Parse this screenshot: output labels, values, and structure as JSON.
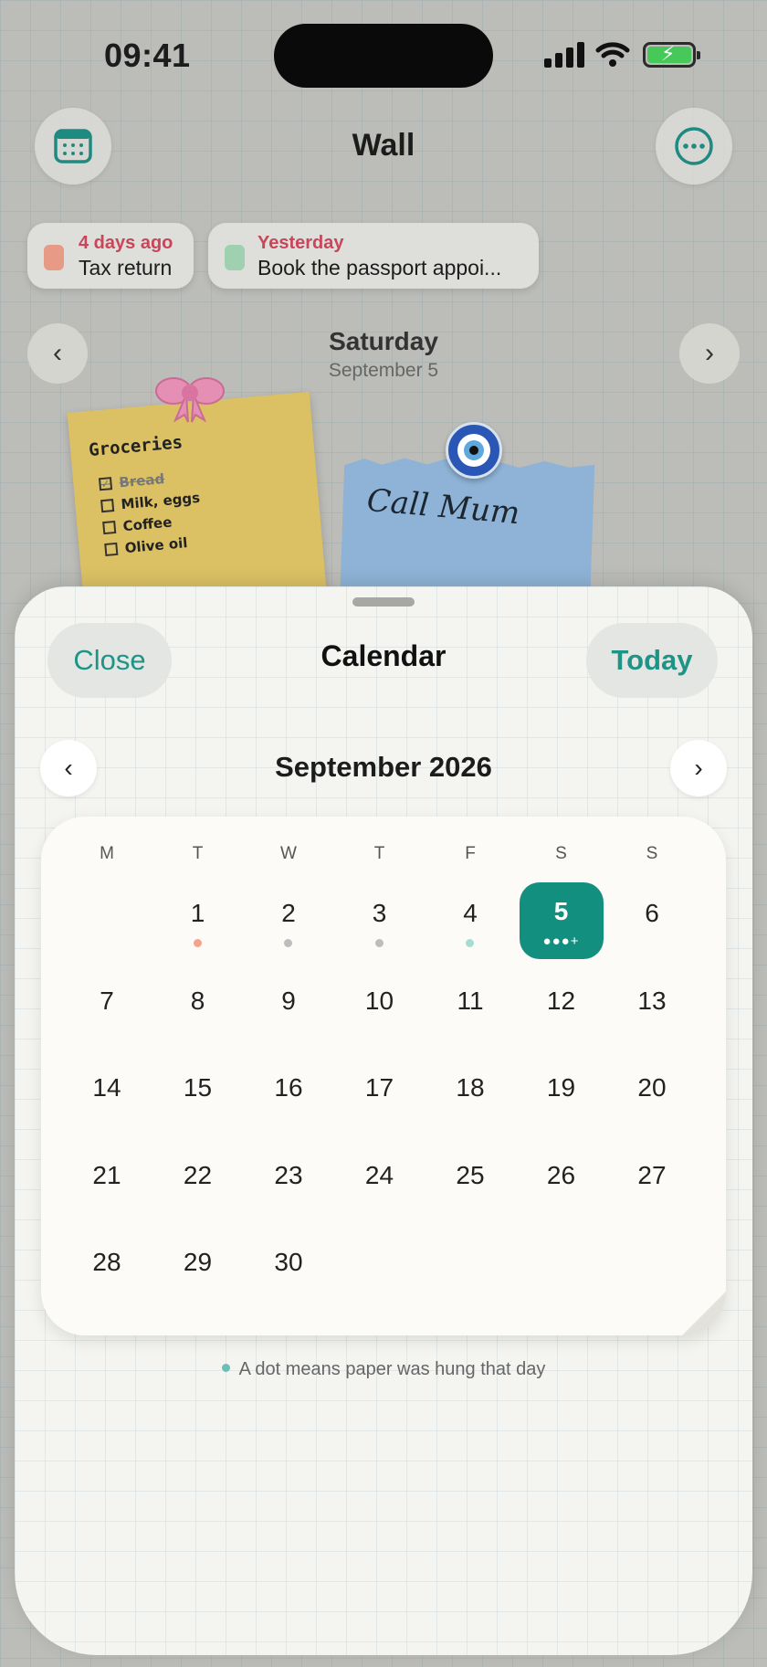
{
  "status": {
    "time": "09:41"
  },
  "header": {
    "title": "Wall"
  },
  "reminders": [
    {
      "when": "4 days ago",
      "text": "Tax return",
      "swatch": "#e79b86"
    },
    {
      "when": "Yesterday",
      "text": "Book the passport appoi...",
      "swatch": "#9fd1b0"
    }
  ],
  "day": {
    "name": "Saturday",
    "date": "September 5"
  },
  "notes": {
    "groceries": {
      "title": "Groceries",
      "items": [
        {
          "label": "Bread",
          "checked": true
        },
        {
          "label": "Milk, eggs",
          "checked": false
        },
        {
          "label": "Coffee",
          "checked": false
        },
        {
          "label": "Olive oil",
          "checked": false
        }
      ]
    },
    "blue": {
      "text": "Call Mum"
    }
  },
  "sheet": {
    "close_label": "Close",
    "title": "Calendar",
    "today_label": "Today",
    "month_title": "September 2026",
    "weekdays": [
      "M",
      "T",
      "W",
      "T",
      "F",
      "S",
      "S"
    ],
    "first_weekday_index": 1,
    "days_in_month": 30,
    "selected_day": 5,
    "selected_marker": "●●●+",
    "day_dots": {
      "1": "#f2a58c",
      "2": "#bdbdbd",
      "3": "#bdbdbd",
      "4": "#a8dccf"
    },
    "legend": "A dot means paper was hung that day",
    "accent": "#138f80"
  }
}
